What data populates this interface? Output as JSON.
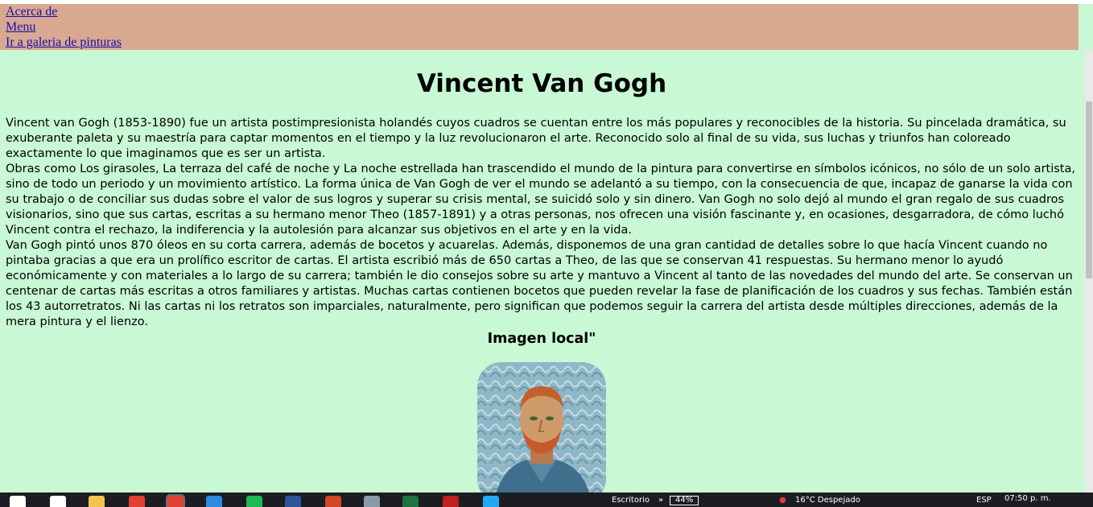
{
  "nav": {
    "links": [
      "Acerca de",
      "Menu",
      "Ir a galeria de pinturas"
    ]
  },
  "page": {
    "title": "Vincent Van Gogh",
    "paragraphs": [
      "Vincent van Gogh (1853-1890) fue un artista postimpresionista holandés cuyos cuadros se cuentan entre los más populares y reconocibles de la historia. Su pincelada dramática, su exuberante paleta y su maestría para captar momentos en el tiempo y la luz revolucionaron el arte. Reconocido solo al final de su vida, sus luchas y triunfos han coloreado exactamente lo que imaginamos que es ser un artista.",
      "Obras como Los girasoles, La terraza del café de noche y La noche estrellada han trascendido el mundo de la pintura para convertirse en símbolos icónicos, no sólo de un solo artista, sino de todo un periodo y un movimiento artístico. La forma única de Van Gogh de ver el mundo se adelantó a su tiempo, con la consecuencia de que, incapaz de ganarse la vida con su trabajo o de conciliar sus dudas sobre el valor de sus logros y superar su crisis mental, se suicidó solo y sin dinero. Van Gogh no solo dejó al mundo el gran regalo de sus cuadros visionarios, sino que sus cartas, escritas a su hermano menor Theo (1857-1891) y a otras personas, nos ofrecen una visión fascinante y, en ocasiones, desgarradora, de cómo luchó Vincent contra el rechazo, la indiferencia y la autolesión para alcanzar sus objetivos en el arte y en la vida.",
      "Van Gogh pintó unos 870 óleos en su corta carrera, además de bocetos y acuarelas. Además, disponemos de una gran cantidad de detalles sobre lo que hacía Vincent cuando no pintaba gracias a que era un prolífico escritor de cartas. El artista escribió más de 650 cartas a Theo, de las que se conservan 41 respuestas. Su hermano menor lo ayudó económicamente y con materiales a lo largo de su carrera; también le dio consejos sobre su arte y mantuvo a Vincent al tanto de las novedades del mundo del arte. Se conservan un centenar de cartas más escritas a otros familiares y artistas. Muchas cartas contienen bocetos que pueden revelar la fase de planificación de los cuadros y sus fechas. También están los 43 autorretratos. Ni las cartas ni los retratos son imparciales, naturalmente, pero significan que podemos seguir la carrera del artista desde múltiples direcciones, además de la mera pintura y el lienzo."
    ],
    "image_heading": "Imagen local\""
  },
  "taskbar": {
    "app_icons": [
      {
        "name": "windows-start-icon",
        "color": "#ffffff"
      },
      {
        "name": "search-icon",
        "color": "#ffffff"
      },
      {
        "name": "file-explorer-icon",
        "color": "#f3c44c"
      },
      {
        "name": "chrome-icon",
        "color": "#e34133"
      },
      {
        "name": "chrome-active-icon",
        "color": "#e34133"
      },
      {
        "name": "app-icon",
        "color": "#2b8be0"
      },
      {
        "name": "spotify-icon",
        "color": "#1db954"
      },
      {
        "name": "word-icon",
        "color": "#2b579a"
      },
      {
        "name": "powerpoint-icon",
        "color": "#d24726"
      },
      {
        "name": "notes-icon",
        "color": "#8a9aa8"
      },
      {
        "name": "excel-icon",
        "color": "#1f7244"
      },
      {
        "name": "pdf-icon",
        "color": "#c0201f"
      },
      {
        "name": "vscode-icon",
        "color": "#23a9f2"
      }
    ],
    "tray": {
      "desktop_label": "Escritorio",
      "battery_label": "44%",
      "weather": "16°C  Despejado",
      "language": "ESP",
      "time": "07:50 p. m."
    }
  }
}
